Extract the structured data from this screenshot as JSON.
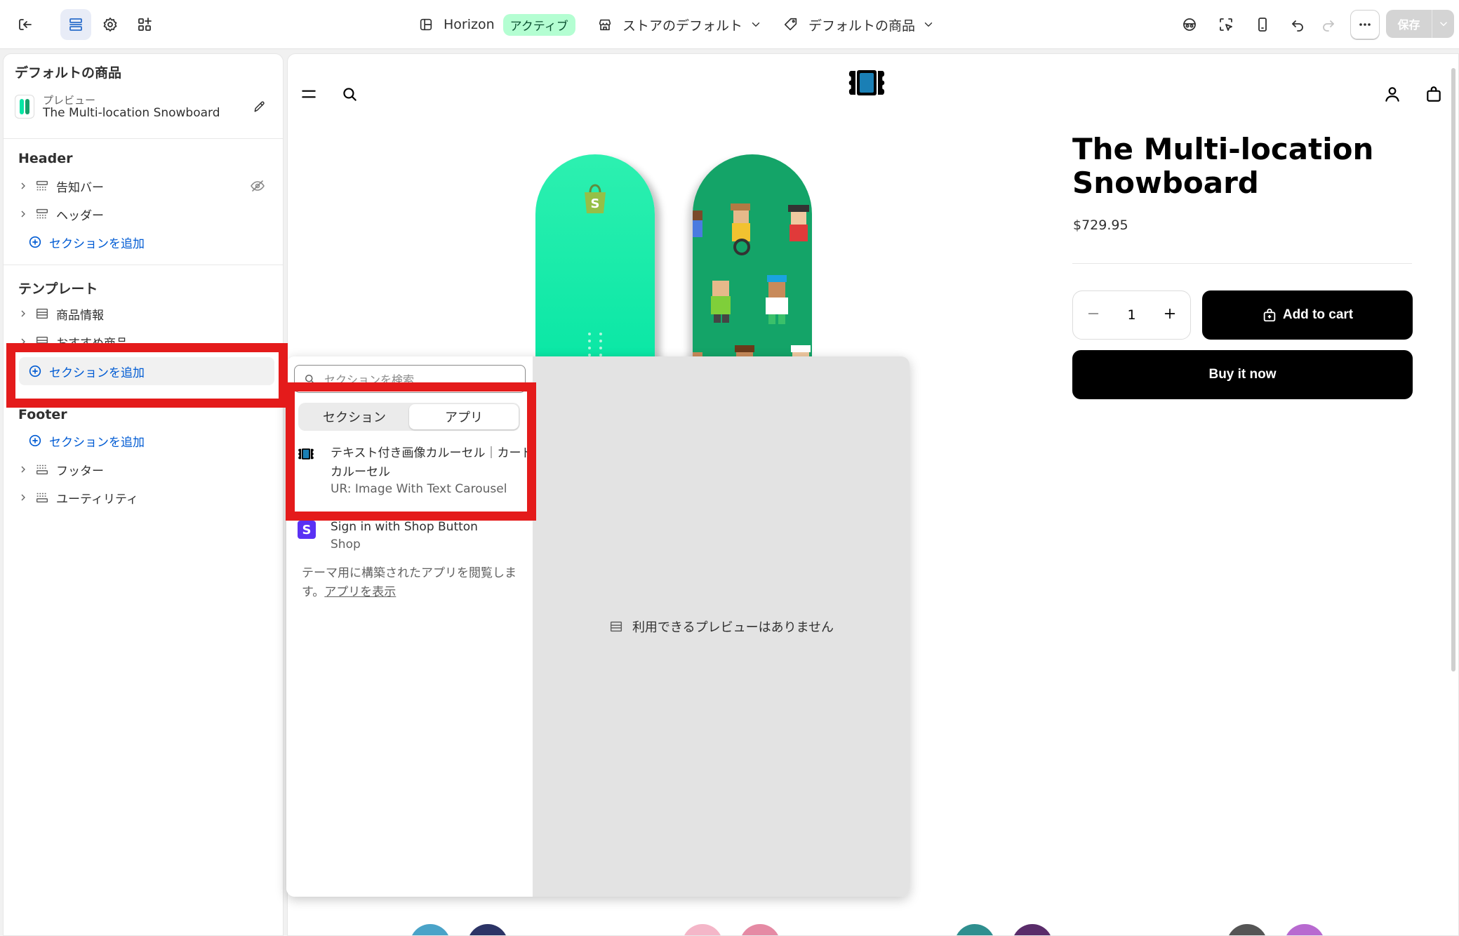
{
  "topbar": {
    "theme_name": "Horizon",
    "theme_status": "アクティブ",
    "store_dropdown": "ストアのデフォルト",
    "template_dropdown": "デフォルトの商品",
    "save_label": "保存"
  },
  "sidebar": {
    "title": "デフォルトの商品",
    "preview_label": "プレビュー",
    "preview_product": "The Multi-location Snowboard",
    "header_group": "Header",
    "header_items": [
      {
        "label": "告知バー",
        "icon": "section-icon"
      },
      {
        "label": "ヘッダー",
        "icon": "section-icon"
      }
    ],
    "add_section": "セクションを追加",
    "template_group": "テンプレート",
    "template_items": [
      {
        "label": "商品情報",
        "icon": "section-icon"
      },
      {
        "label": "おすすめ商品",
        "icon": "section-icon"
      }
    ],
    "footer_group": "Footer",
    "footer_items": [
      {
        "label": "フッター",
        "icon": "section-icon"
      },
      {
        "label": "ユーティリティ",
        "icon": "section-icon"
      }
    ]
  },
  "preview": {
    "product_title": "The Multi-location Snowboard",
    "price": "$729.95",
    "quantity": "1",
    "add_to_cart": "Add to cart",
    "buy_now": "Buy it now"
  },
  "picker": {
    "search_placeholder": "セクションを検索",
    "tabs": [
      "セクション",
      "アプリ"
    ],
    "active_tab": "アプリ",
    "apps": [
      {
        "name": "テキスト付き画像カルーセル｜カードカルーセル",
        "vendor": "UR: Image With Text Carousel"
      },
      {
        "name": "Sign in with Shop Button",
        "vendor": "Shop"
      }
    ],
    "browse_text": "テーマ用に構築されたアプリを閲覧します。",
    "browse_link": "アプリを表示",
    "no_preview": "利用できるプレビューはありません"
  },
  "colors": {
    "accent": "#005bd3",
    "highlight": "#e41b1b",
    "badge_bg": "#b4fed2",
    "board_mint": "#06e6a4",
    "board_green": "#14a468"
  }
}
